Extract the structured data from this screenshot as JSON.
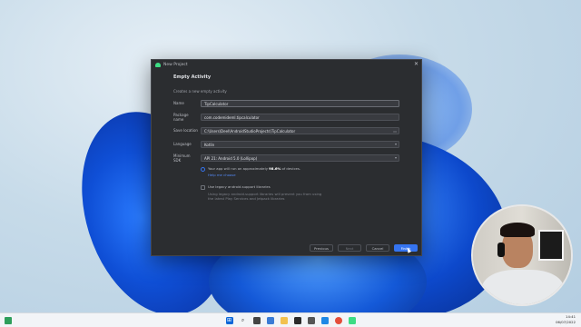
{
  "dialog": {
    "window_title": "New Project",
    "heading": "Empty Activity",
    "description": "Creates a new empty activity",
    "fields": [
      {
        "label": "Name",
        "value": "TipCalculator"
      },
      {
        "label": "Package name",
        "value": "com.codemideml.tipcalculator"
      },
      {
        "label": "Save location",
        "value": "C:\\Users\\Deel\\AndroidStudioProjects\\TipCalculator"
      },
      {
        "label": "Language",
        "value": "Kotlin"
      },
      {
        "label": "Minimum SDK",
        "value": "API 21: Android 5.0 (Lollipop)"
      }
    ],
    "info_text_before": "Your app will run on approximately ",
    "info_percent": "98.6%",
    "info_text_after": " of devices.",
    "help_link": "Help me choose",
    "legacy_checkbox_label": "Use legacy android.support libraries",
    "legacy_checkbox_checked": false,
    "legacy_description": "Using legacy android.support libraries will prevent you from using the latest Play Services and Jetpack libraries",
    "buttons": {
      "previous": "Previous",
      "next": "Next",
      "cancel": "Cancel",
      "finish": "Finish"
    }
  },
  "taskbar": {
    "icons": [
      "windows-start-icon",
      "search-icon",
      "task-view-icon",
      "widgets-icon",
      "file-explorer-icon",
      "store-icon",
      "terminal-icon",
      "vscode-icon",
      "chrome-icon",
      "android-studio-icon"
    ],
    "time": "14:41",
    "date": "06/07/2022"
  },
  "colors": {
    "dialog_bg": "#2b2d30",
    "accent": "#3574f0",
    "taskbar_bg": "#f2f4f7"
  }
}
